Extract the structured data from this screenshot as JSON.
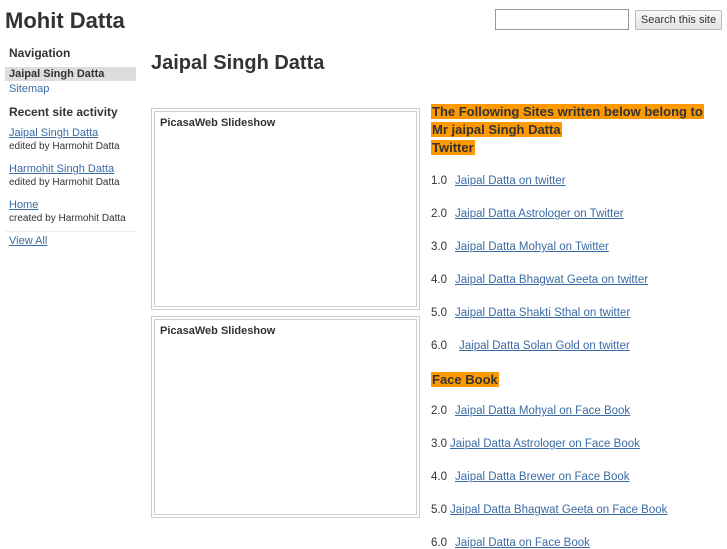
{
  "site_title": "Mohit Datta",
  "search": {
    "placeholder": "",
    "button": "Search this site"
  },
  "sidebar": {
    "nav_heading": "Navigation",
    "nav_items": [
      "Jaipal Singh Datta",
      "Sitemap"
    ],
    "activity_heading": "Recent site activity",
    "activity": [
      {
        "title": "Jaipal Singh Datta",
        "by": "edited by Harmohit Datta"
      },
      {
        "title": "Harmohit Singh Datta",
        "by": "edited by Harmohit Datta"
      },
      {
        "title": "Home",
        "by": "created by Harmohit Datta"
      }
    ],
    "view_all": "View All"
  },
  "page_title": "Jaipal Singh Datta",
  "slideshows": [
    "PicasaWeb Slideshow",
    "PicasaWeb Slideshow"
  ],
  "content": {
    "heading_line1": "The Following Sites written below belong to",
    "heading_line2": "Mr jaipal Singh Datta",
    "twitter_heading": "Twitter",
    "twitter": [
      {
        "n": "1.0",
        "label": "Jaipal Datta on twitter"
      },
      {
        "n": "2.0",
        "label": "Jaipal Datta Astrologer on Twitter"
      },
      {
        "n": "3.0",
        "label": "Jaipal Datta Mohyal on Twitter "
      },
      {
        "n": "4.0",
        "label": "Jaipal Datta Bhagwat Geeta on twitter"
      },
      {
        "n": "5.0",
        "label": "Jaipal Datta Shakti Sthal on twitter"
      },
      {
        "n": "6.0",
        "label": "Jaipal Datta Solan Gold on twitter"
      }
    ],
    "facebook_heading": "Face Book",
    "facebook": [
      {
        "n": "2.0",
        "label": "Jaipal Datta Mohyal on Face Book "
      },
      {
        "n": "3.0",
        "label": "Jaipal Datta Astrologer on Face Book "
      },
      {
        "n": "4.0",
        "label": "Jaipal Datta Brewer on Face Book "
      },
      {
        "n": "5.0",
        "label": "Jaipal Datta Bhagwat Geeta on Face Book "
      },
      {
        "n": "6.0",
        "label": "Jaipal Datta on Face Book"
      }
    ],
    "accent": "#ff9900"
  }
}
